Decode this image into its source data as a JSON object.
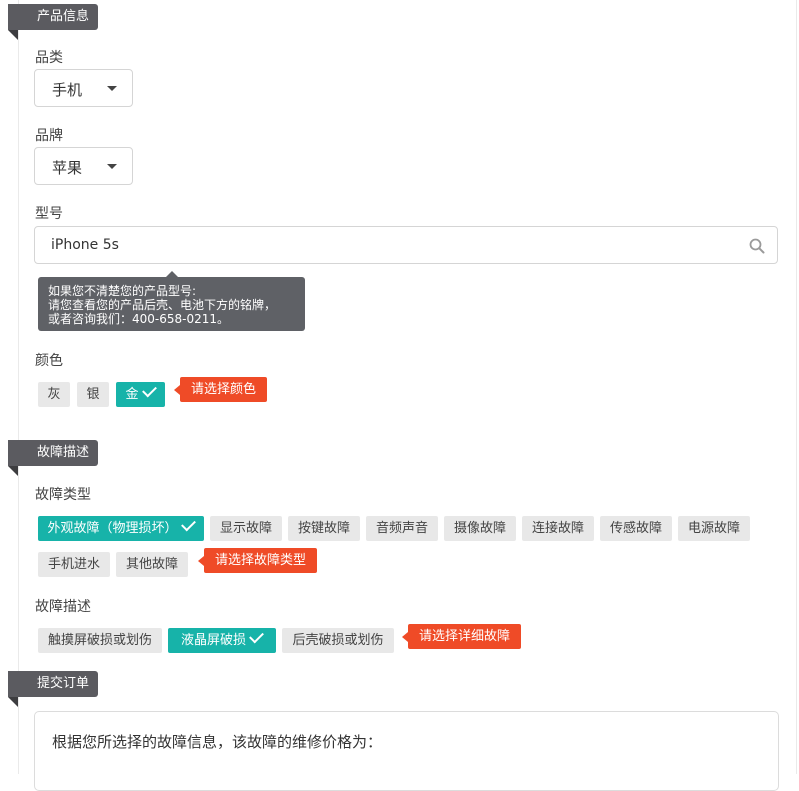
{
  "product_info": {
    "section_title": "产品信息",
    "category": {
      "label": "品类",
      "value": "手机"
    },
    "brand": {
      "label": "品牌",
      "value": "苹果"
    },
    "model": {
      "label": "型号",
      "value": "iPhone 5s",
      "icon": "search-icon",
      "tooltip": [
        "如果您不清楚您的产品型号:",
        "请您查看您的产品后壳、电池下方的铭牌，",
        "或者咨询我们：400-658-0211。"
      ]
    },
    "color": {
      "label": "颜色",
      "options": [
        "灰",
        "银",
        "金"
      ],
      "selected": "金",
      "warning": "请选择颜色"
    }
  },
  "fault_description": {
    "section_title": "故障描述",
    "fault_type": {
      "label": "故障类型",
      "options": [
        "外观故障（物理损坏）",
        "显示故障",
        "按键故障",
        "音频声音",
        "摄像故障",
        "连接故障",
        "传感故障",
        "电源故障",
        "手机进水",
        "其他故障"
      ],
      "selected": "外观故障（物理损坏）",
      "warning": "请选择故障类型"
    },
    "fault_detail": {
      "label": "故障描述",
      "options": [
        "触摸屏破损或划伤",
        "液晶屏破损",
        "后壳破损或划伤"
      ],
      "selected": "液晶屏破损",
      "warning": "请选择详细故障"
    }
  },
  "submit_order": {
    "section_title": "提交订单",
    "result_text": "根据您所选择的故障信息，该故障的维修价格为："
  },
  "colors": {
    "accent": "#17b3a9",
    "warning": "#ef4b27",
    "tab": "#5b5b60"
  }
}
